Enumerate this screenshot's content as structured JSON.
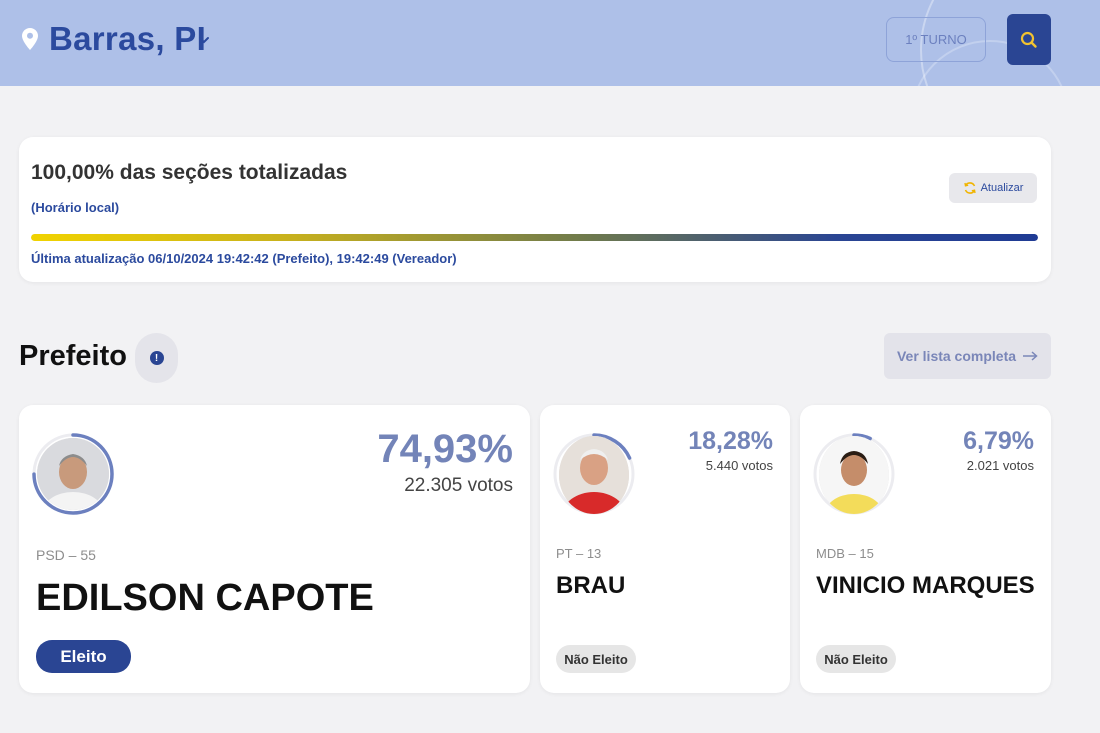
{
  "header": {
    "city": "Barras, PI",
    "round_label": "1º TURNO",
    "icons": {
      "location": "location-pin-icon",
      "dropdown": "chevron-down-icon",
      "search": "search-icon"
    }
  },
  "status": {
    "title": "100,00% das seções totalizadas",
    "subtitle": "(Horário local)",
    "refresh_label": "Atualizar",
    "progress_percent": 100,
    "last_update": "Última atualização 06/10/2024 19:42:42 (Prefeito), 19:42:49 (Vereador)"
  },
  "section": {
    "title": "Prefeito",
    "list_button": "Ver lista completa"
  },
  "candidates": [
    {
      "percent": "74,93%",
      "votes": "22.305 votos",
      "party": "PSD – 55",
      "name": "EDILSON CAPOTE",
      "status": "Eleito",
      "ring_fraction": 0.7493
    },
    {
      "percent": "18,28%",
      "votes": "5.440 votos",
      "party": "PT – 13",
      "name": "BRAU",
      "status": "Não Eleito",
      "ring_fraction": 0.1828
    },
    {
      "percent": "6,79%",
      "votes": "2.021 votos",
      "party": "MDB – 15",
      "name": "VINICIO MARQUES",
      "status": "Não Eleito",
      "ring_fraction": 0.0679
    }
  ],
  "colors": {
    "header_bg": "#aec0e8",
    "brand_blue": "#2a4593",
    "percent_color": "#7384b8",
    "ring_color": "#6c80bf"
  }
}
